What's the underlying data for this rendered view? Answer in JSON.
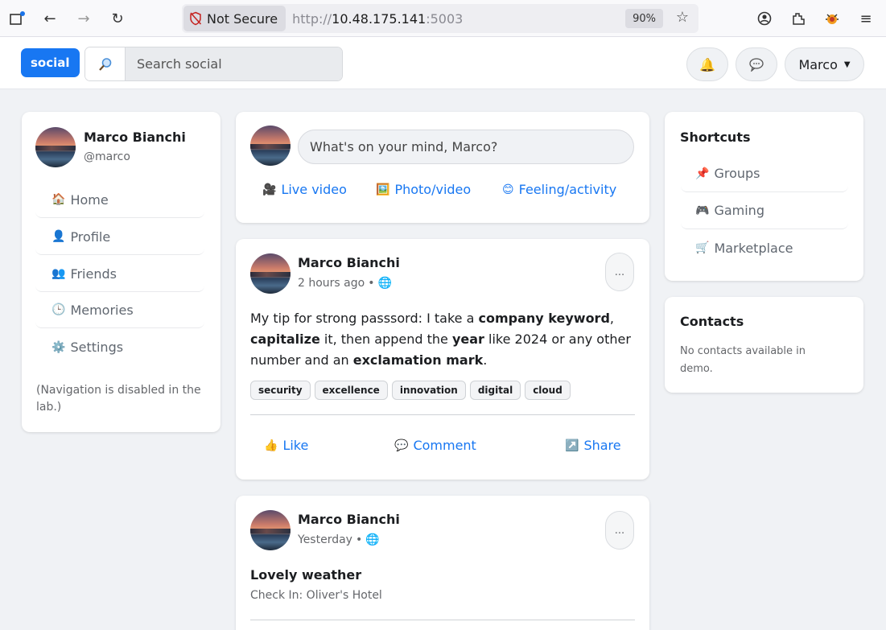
{
  "browser": {
    "not_secure_label": "Not Secure",
    "url_prefix": "http://",
    "url_host": "10.48.175.141",
    "url_port": ":5003",
    "zoom": "90%"
  },
  "header": {
    "brand": "social",
    "search_placeholder": "Search social",
    "user_menu_label": "Marco"
  },
  "profile": {
    "name": "Marco Bianchi",
    "handle": "@marco"
  },
  "nav": {
    "items": [
      {
        "icon": "🏠",
        "label": "Home"
      },
      {
        "icon": "👤",
        "label": "Profile"
      },
      {
        "icon": "👥",
        "label": "Friends"
      },
      {
        "icon": "🕒",
        "label": "Memories"
      },
      {
        "icon": "⚙️",
        "label": "Settings"
      }
    ],
    "note": "(Navigation is disabled in the lab.)"
  },
  "composer": {
    "placeholder": "What's on your mind, Marco?",
    "actions": [
      {
        "icon": "🎥",
        "label": "Live video"
      },
      {
        "icon": "🖼️",
        "label": "Photo/video"
      },
      {
        "icon": "😊",
        "label": "Feeling/activity"
      }
    ]
  },
  "posts": [
    {
      "author": "Marco Bianchi",
      "time": "2 hours ago",
      "more_label": "...",
      "body_parts": [
        {
          "t": "My tip for strong passsord: I take a ",
          "b": false
        },
        {
          "t": "company keyword",
          "b": true
        },
        {
          "t": ", ",
          "b": false
        },
        {
          "t": "capitalize",
          "b": true
        },
        {
          "t": " it, then append the ",
          "b": false
        },
        {
          "t": "year",
          "b": true
        },
        {
          "t": " like 2024 or any other number and an ",
          "b": false
        },
        {
          "t": "exclamation mark",
          "b": true
        },
        {
          "t": ".",
          "b": false
        }
      ],
      "tags": [
        "security",
        "excellence",
        "innovation",
        "digital",
        "cloud"
      ],
      "actions": [
        {
          "icon": "👍",
          "label": "Like"
        },
        {
          "icon": "💬",
          "label": "Comment"
        },
        {
          "icon": "↗️",
          "label": "Share"
        }
      ]
    },
    {
      "author": "Marco Bianchi",
      "time": "Yesterday",
      "more_label": "...",
      "title": "Lovely weather",
      "checkin": "Check In: Oliver's Hotel"
    }
  ],
  "shortcuts": {
    "title": "Shortcuts",
    "items": [
      {
        "icon": "📌",
        "label": "Groups"
      },
      {
        "icon": "🎮",
        "label": "Gaming"
      },
      {
        "icon": "🛒",
        "label": "Marketplace"
      }
    ]
  },
  "contacts": {
    "title": "Contacts",
    "empty_text": "No contacts available in demo."
  }
}
